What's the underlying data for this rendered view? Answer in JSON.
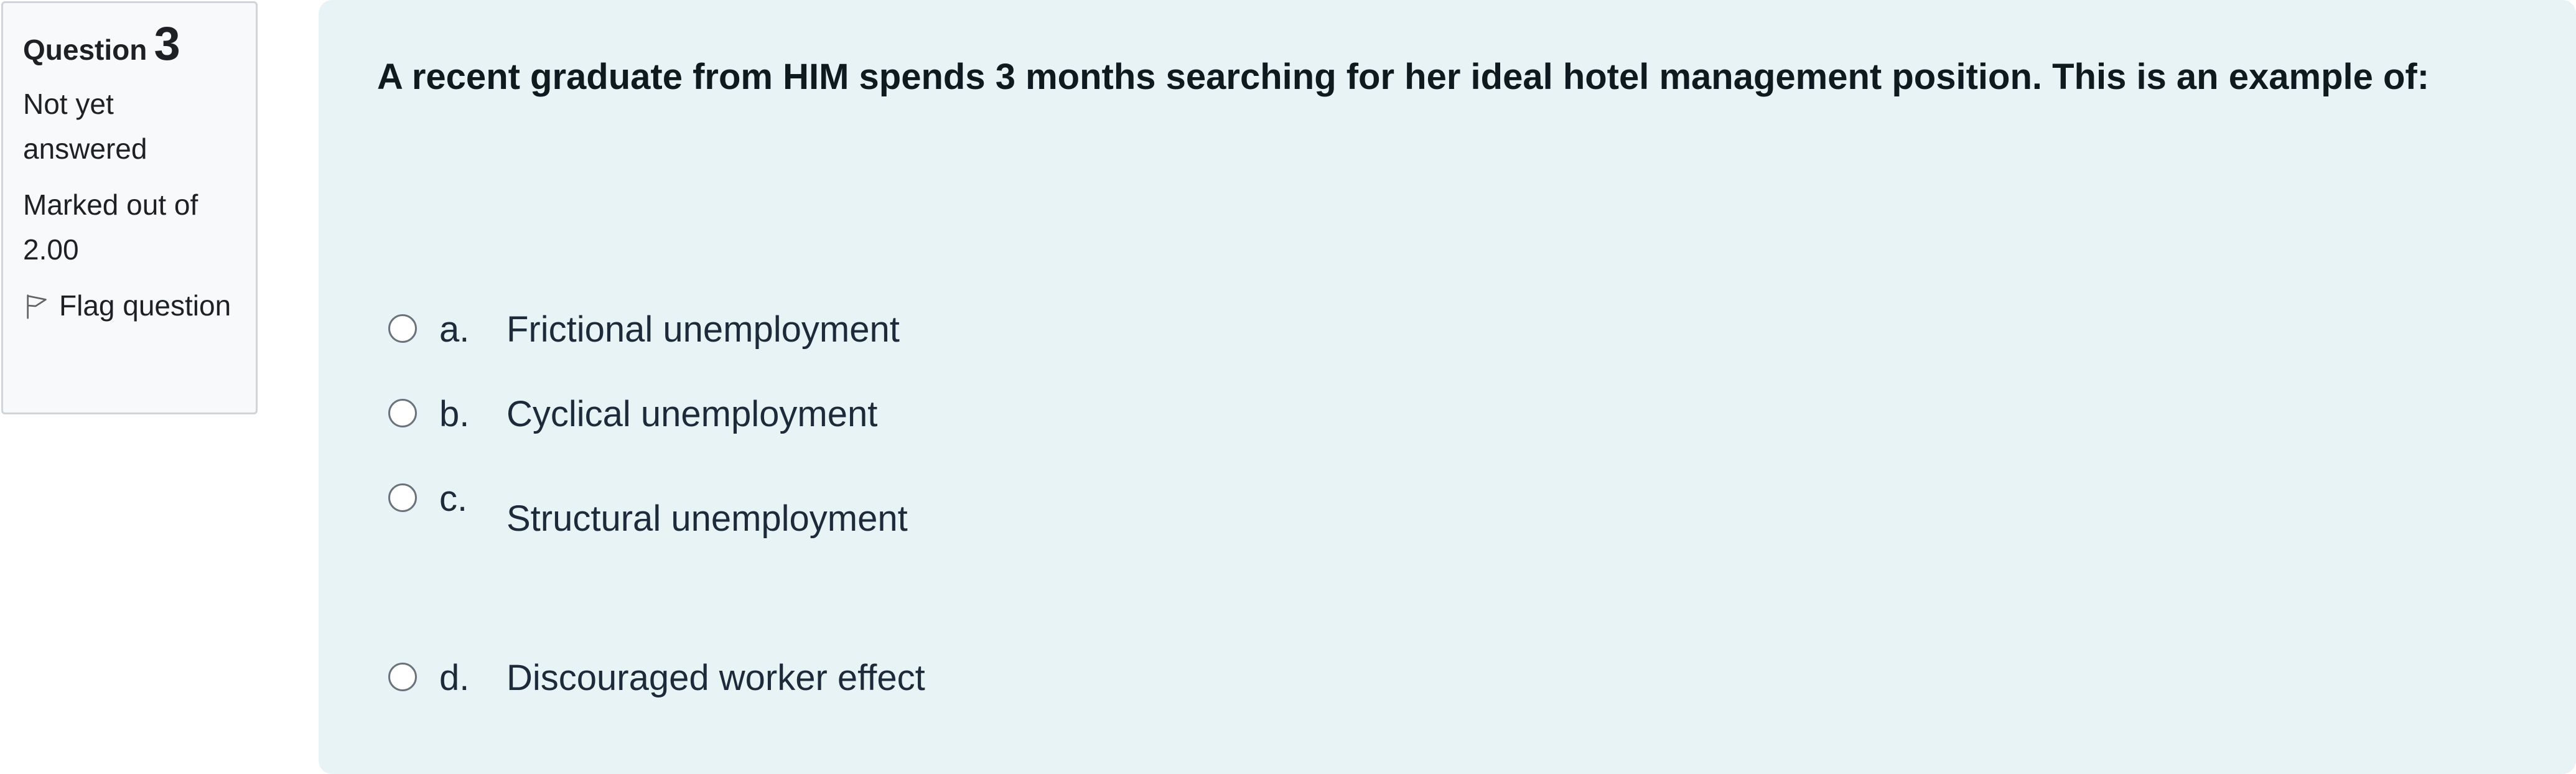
{
  "info": {
    "question_word": "Question",
    "question_number": "3",
    "state": "Not yet answered",
    "grade": "Marked out of 2.00",
    "flag_label": "Flag question"
  },
  "question": {
    "text": "A recent graduate from HIM spends 3 months searching for her ideal hotel management position. This is an example of:",
    "options": [
      {
        "letter": "a.",
        "text": "Frictional unemployment",
        "selected": false
      },
      {
        "letter": "b.",
        "text": "Cyclical unemployment",
        "selected": false
      },
      {
        "letter": "c.",
        "text": "Structural unemployment",
        "selected": false
      },
      {
        "letter": "d.",
        "text": "Discouraged worker effect",
        "selected": false
      }
    ]
  },
  "icons": {
    "flag": "flag-icon",
    "radio": "radio-unchecked-icon"
  },
  "colors": {
    "panel_background": "#e7f3f5",
    "info_background": "#f8f9fa",
    "info_border": "#cfd4da"
  }
}
